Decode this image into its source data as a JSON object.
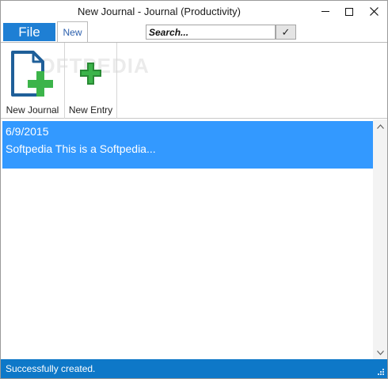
{
  "window": {
    "title": "New Journal - Journal (Productivity)",
    "controls": {
      "minimize": "minimize-icon",
      "maximize": "maximize-icon",
      "close": "close-icon"
    }
  },
  "tabs": {
    "file_label": "File",
    "new_label": "New"
  },
  "search": {
    "placeholder": "Search...",
    "value": "",
    "button_icon": "checkmark-icon",
    "button_glyph": "✓"
  },
  "ribbon": {
    "watermark": "SOFTPEDIA",
    "buttons": [
      {
        "label": "New Journal",
        "icon": "new-journal-icon"
      },
      {
        "label": "New Entry",
        "icon": "new-entry-icon"
      }
    ]
  },
  "entries": [
    {
      "date": "6/9/2015",
      "preview": "Softpedia This is a Softpedia..."
    }
  ],
  "status": {
    "message": "Successfully created."
  },
  "colors": {
    "accent": "#1e7fd4",
    "selection": "#3399ff",
    "statusbar": "#0e78c8",
    "plus_green": "#3cb44a"
  }
}
